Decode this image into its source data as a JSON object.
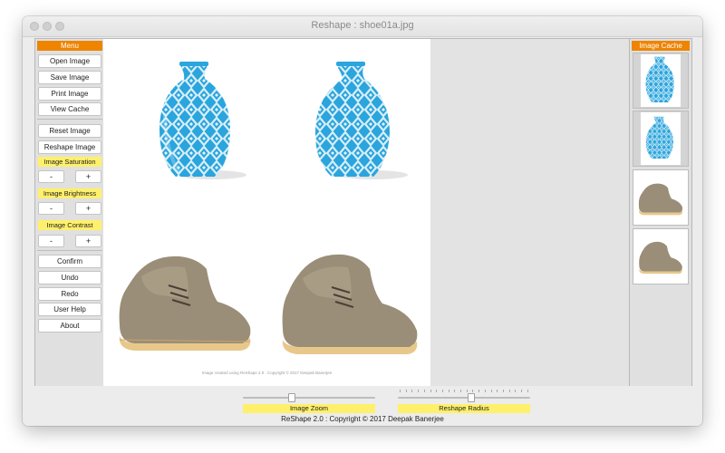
{
  "window": {
    "title": "Reshape : shoe01a.jpg"
  },
  "menu": {
    "header": "Menu",
    "buttons": [
      "Open Image",
      "Save Image",
      "Print Image",
      "View Cache",
      "Reset Image",
      "Reshape Image"
    ],
    "saturation_label": "Image Saturation",
    "brightness_label": "Image Brightness",
    "contrast_label": "Image Contrast",
    "minus": "-",
    "plus": "+",
    "actions": [
      "Confirm",
      "Undo",
      "Redo",
      "User Help",
      "About"
    ]
  },
  "canvas": {
    "caption": "Image created using ReShape 2.0 : Copyright © 2017  Deepak Banerjee"
  },
  "cache": {
    "header": "Image Cache",
    "items": [
      "vase-thumbnail",
      "vase-thumbnail",
      "shoe-thumbnail",
      "shoe-thumbnail"
    ]
  },
  "controls": {
    "zoom_label": "Image Zoom",
    "zoom_value": 0.36,
    "radius_label": "Reshape Radius",
    "radius_value": 0.55
  },
  "footer": {
    "copyright": "ReShape 2.0 : Copyright © 2017  Deepak Banerjee"
  },
  "colors": {
    "accent_header": "#ee8400",
    "label_yellow": "#fff06b",
    "vase_blue": "#2aa5dd"
  }
}
